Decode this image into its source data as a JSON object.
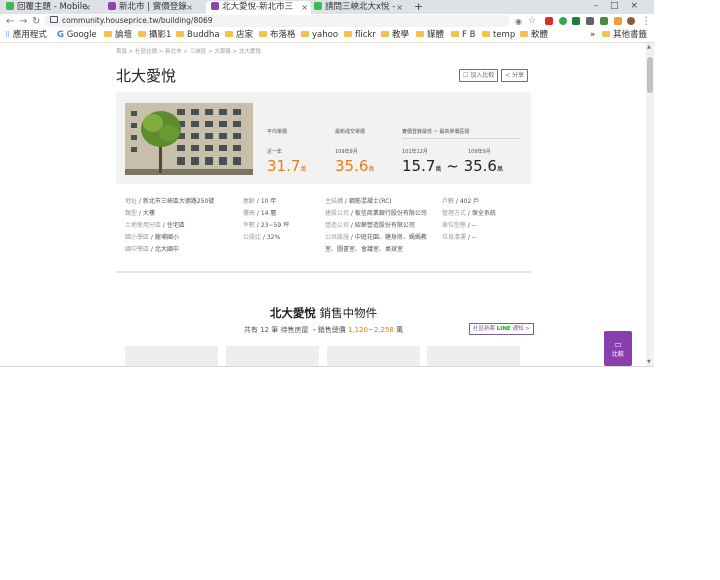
{
  "browser": {
    "tabs": [
      {
        "title": "回覆主題 - Mobile",
        "color": "#3cba54"
      },
      {
        "title": "新北市 | 實價登錄　",
        "color": "#8e44ad"
      },
      {
        "title": "北大愛悅-新北市三",
        "color": "#8e44ad"
      },
      {
        "title": "請問三峽北大x悅 -",
        "color": "#3cba54"
      }
    ],
    "new_tab": "+",
    "window_controls": "–□×",
    "url": "community.houseprice.tw/building/8069",
    "bookmarks": [
      "應用程式",
      "Google",
      "論壇",
      "攝影1",
      "Buddha",
      "店家",
      "布落格",
      "yahoo",
      "flickr",
      "教學",
      "媒體",
      "F B",
      "temp",
      "軟體"
    ],
    "bookmarks_overflow": "»",
    "other_bookmarks": "其他書籤"
  },
  "page": {
    "breadcrumb": "首頁 > 社區比價 > 新北市 > 三峽區 > 大學路 > 北大愛悅",
    "title": "北大愛悅",
    "add_compare": "加入比較",
    "share": "分享",
    "stats": {
      "avg_label": "平均單價",
      "avg_period": "近一年",
      "avg_value": "31.7",
      "latest_label": "最新成交單價",
      "latest_date": "109年9月",
      "latest_value": "35.6",
      "range_label": "實價登錄最低 ~ 最高單價區間",
      "range_from_date": "101年12月",
      "range_to_date": "109年9月",
      "range_low": "15.7",
      "range_tilde": "~",
      "range_high": "35.6",
      "unit": "萬"
    },
    "info": {
      "col1": [
        [
          "地址",
          "新北市三峽區大德路250號"
        ],
        [
          "類型",
          "大樓"
        ],
        [
          "土地使用分區",
          "住宅區"
        ],
        [
          "國小學區",
          "龍埔國小"
        ],
        [
          "國中學區",
          "北大國中"
        ]
      ],
      "col2": [
        [
          "屋齡",
          "10 年"
        ],
        [
          "樓高",
          "14 層"
        ],
        [
          "坪數",
          "23~59 坪"
        ],
        [
          "公設比",
          "32%"
        ]
      ],
      "col3": [
        [
          "主結構",
          "鋼筋混凝土(RC)"
        ],
        [
          "建設公司",
          "板信商業銀行股份有限公司"
        ],
        [
          "營造公司",
          "紹華營造股份有限公司"
        ],
        [
          "公共設施",
          "中庭花園、健身房、媽媽教室、圖書室、會議室、桌球室"
        ]
      ],
      "col4": [
        [
          "戶數",
          "402 戶"
        ],
        [
          "管理方式",
          "保全系統"
        ],
        [
          "車位型態",
          "--"
        ],
        [
          "垃圾清運",
          "--"
        ]
      ]
    },
    "section": {
      "name": "北大愛悅",
      "title_suffix": "銷售中物件",
      "summary_prefix": "共有",
      "count": "12",
      "summary_mid": "筆 待售房屋 ・銷售總價",
      "price_range": "1,120~2,258",
      "unit": "萬",
      "notify_label": "社區新案",
      "notify_line": "LINE",
      "notify_suffix": "通知 >"
    },
    "compare_button": "比較"
  },
  "colors": {
    "accent": "#e97b1b",
    "brand": "#7d6290",
    "compare_bg": "#8a3fae"
  }
}
